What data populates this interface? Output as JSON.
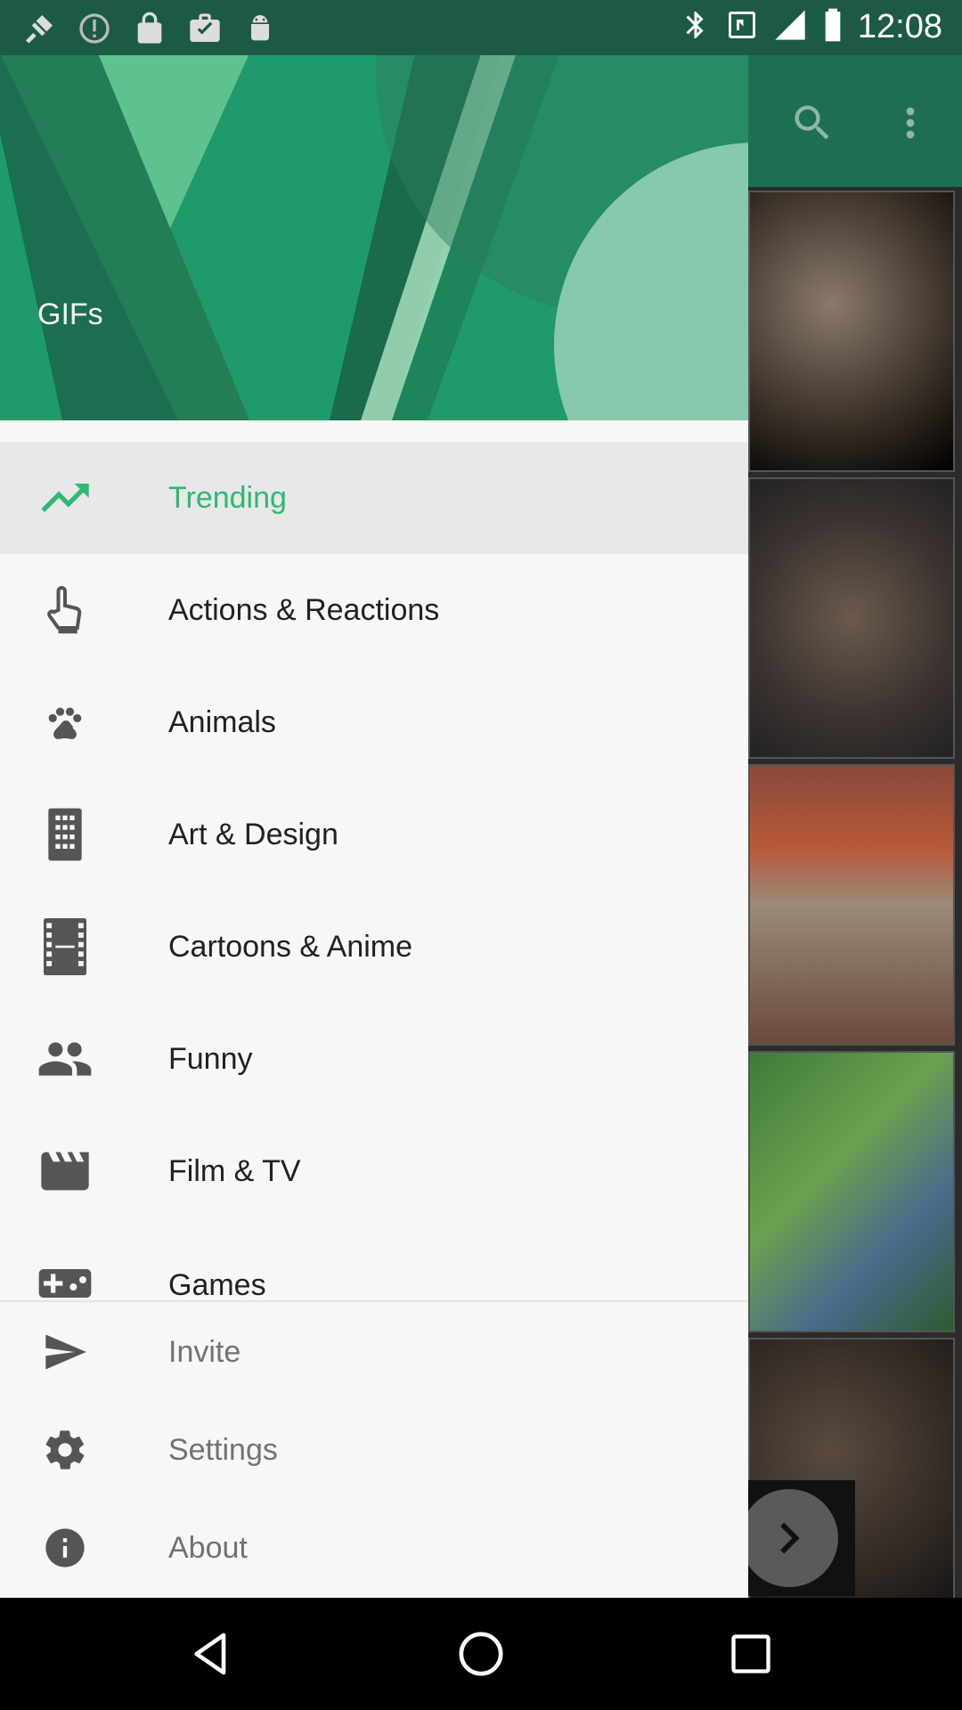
{
  "status_bar": {
    "time": "12:08",
    "left_icons": [
      "location-icon",
      "alert-icon",
      "lock-icon",
      "briefcase-icon",
      "android-icon"
    ],
    "right_icons": [
      "bluetooth-icon",
      "nfc-icon",
      "signal-icon",
      "battery-icon"
    ]
  },
  "app_toolbar": {
    "icons": [
      "search-icon",
      "more-vert-icon"
    ]
  },
  "drawer": {
    "header_title": "GIFs",
    "items": [
      {
        "label": "Trending",
        "icon": "trending-up-icon",
        "active": true
      },
      {
        "label": "Actions & Reactions",
        "icon": "hand-pointer-icon"
      },
      {
        "label": "Animals",
        "icon": "paw-icon"
      },
      {
        "label": "Art & Design",
        "icon": "building-icon"
      },
      {
        "label": "Cartoons & Anime",
        "icon": "film-strip-icon"
      },
      {
        "label": "Funny",
        "icon": "people-icon"
      },
      {
        "label": "Film & TV",
        "icon": "clapperboard-icon"
      },
      {
        "label": "Games",
        "icon": "gamepad-icon"
      }
    ],
    "secondary_items": [
      {
        "label": "Invite",
        "icon": "send-icon"
      },
      {
        "label": "Settings",
        "icon": "gear-icon"
      },
      {
        "label": "About",
        "icon": "info-icon"
      }
    ]
  },
  "colors": {
    "accent": "#2fb872",
    "header_green": "#1f9a6a",
    "icon_gray": "#555555"
  },
  "nav_bar": {
    "buttons": [
      "back-icon",
      "home-icon",
      "recents-icon"
    ]
  }
}
